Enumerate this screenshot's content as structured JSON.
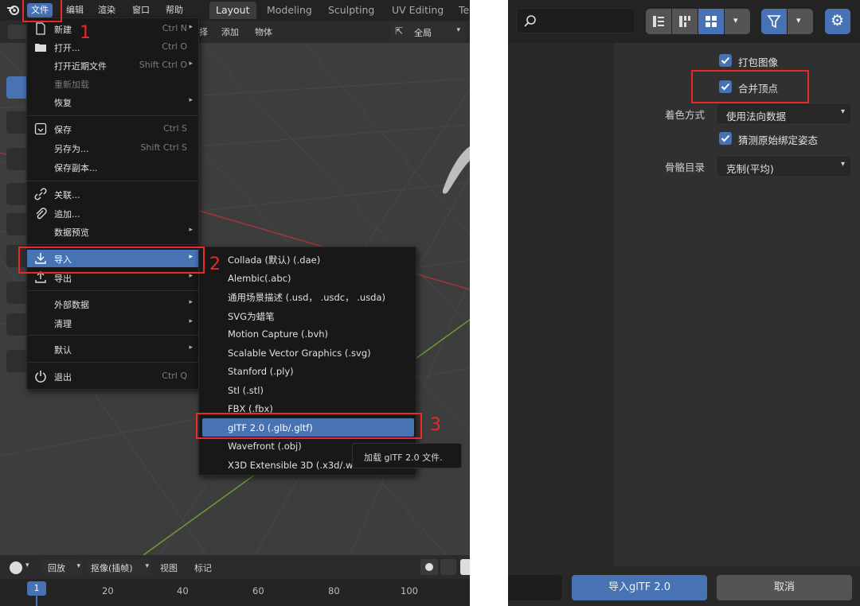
{
  "left": {
    "topbar": {
      "menus": [
        "文件",
        "编辑",
        "渲染",
        "窗口",
        "帮助"
      ],
      "workspace_tabs": [
        "Layout",
        "Modeling",
        "Sculpting",
        "UV Editing",
        "Te"
      ]
    },
    "header": {
      "items": [
        "择",
        "添加",
        "物体"
      ],
      "orientation": "全局"
    },
    "file_menu": {
      "items": [
        {
          "label": "新建",
          "shortcut": "Ctrl N",
          "icon": "new-file-icon",
          "submenu": true
        },
        {
          "label": "打开...",
          "shortcut": "Ctrl O",
          "icon": "folder-icon"
        },
        {
          "label": "打开近期文件",
          "shortcut": "Shift Ctrl O",
          "submenu": true
        },
        {
          "label": "重新加载",
          "shortcut": "",
          "disabled": true
        },
        {
          "label": "恢复",
          "shortcut": "",
          "submenu": true
        },
        {
          "label": "保存",
          "shortcut": "Ctrl S",
          "icon": "save-icon"
        },
        {
          "label": "另存为...",
          "shortcut": "Shift Ctrl S"
        },
        {
          "label": "保存副本...",
          "shortcut": ""
        },
        {
          "label": "关联...",
          "shortcut": "",
          "icon": "link-icon"
        },
        {
          "label": "追加...",
          "shortcut": "",
          "icon": "paperclip-icon"
        },
        {
          "label": "数据预览",
          "shortcut": "",
          "submenu": true
        },
        {
          "label": "导入",
          "shortcut": "",
          "icon": "import-icon",
          "submenu": true,
          "highlighted": true
        },
        {
          "label": "导出",
          "shortcut": "",
          "icon": "export-icon",
          "submenu": true
        },
        {
          "label": "外部数据",
          "shortcut": "",
          "submenu": true
        },
        {
          "label": "清理",
          "shortcut": "",
          "submenu": true
        },
        {
          "label": "默认",
          "shortcut": "",
          "submenu": true
        },
        {
          "label": "退出",
          "shortcut": "Ctrl Q",
          "icon": "power-icon"
        }
      ]
    },
    "import_submenu": {
      "items": [
        "Collada (默认) (.dae)",
        "Alembic(.abc)",
        "通用场景描述 (.usd， .usdc， .usda)",
        "SVG为蜡笔",
        "Motion Capture (.bvh)",
        "Scalable Vector Graphics (.svg)",
        "Stanford (.ply)",
        "Stl (.stl)",
        "FBX (.fbx)",
        "glTF 2.0 (.glb/.gltf)",
        "Wavefront (.obj)",
        "X3D Extensible 3D (.x3d/.w"
      ],
      "highlighted_index": 9
    },
    "tooltip": "加载 glTF 2.0 文件.",
    "step_numbers": [
      "1",
      "2",
      "3"
    ],
    "timeline": {
      "playback": "回放",
      "keying": "抠像(插帧)",
      "view": "视图",
      "marker": "标记",
      "current_frame": "1",
      "frame_ticks": [
        "20",
        "40",
        "60",
        "80",
        "100"
      ]
    }
  },
  "right": {
    "options": {
      "pack_images": {
        "label": "打包图像",
        "checked": true
      },
      "merge_vertices": {
        "label": "合并顶点",
        "checked": true
      },
      "shading": {
        "label": "着色方式",
        "value": "使用法向数据"
      },
      "guess_bind_pose": {
        "label": "猜测原始绑定姿态",
        "checked": true
      },
      "bone_dir": {
        "label": "骨骼目录",
        "value": "克制(平均)"
      }
    },
    "buttons": {
      "import": "导入glTF 2.0",
      "cancel": "取消"
    }
  },
  "colors": {
    "accent": "#4772b3",
    "highlight_box": "#e8282a",
    "x_axis": "#a8343d",
    "y_axis": "#6a9e2f"
  }
}
